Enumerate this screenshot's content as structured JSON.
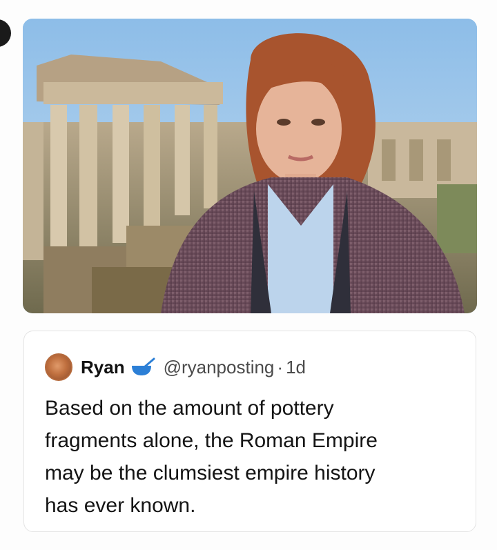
{
  "photo": {
    "subject_icon": "reporter-in-front-of-ruins-photo",
    "colors": {
      "sky": "#9cc7ec",
      "ruins": "#cdbba0",
      "hair": "#a8542e",
      "jacket": "#6a4a58",
      "shirt": "#bcd4ec"
    }
  },
  "tweet": {
    "display_name": "Ryan",
    "badge_icon": "bowl-spoon-icon",
    "handle": "@ryanposting",
    "separator": "·",
    "timestamp": "1d",
    "text_lines": [
      "Based on the amount of pottery",
      "fragments alone, the Roman Empire",
      "may be the clumsiest empire history",
      "has ever known."
    ],
    "colors": {
      "name": "#111111",
      "meta": "#4a4a4a",
      "badge": "#2c7fd6"
    }
  }
}
